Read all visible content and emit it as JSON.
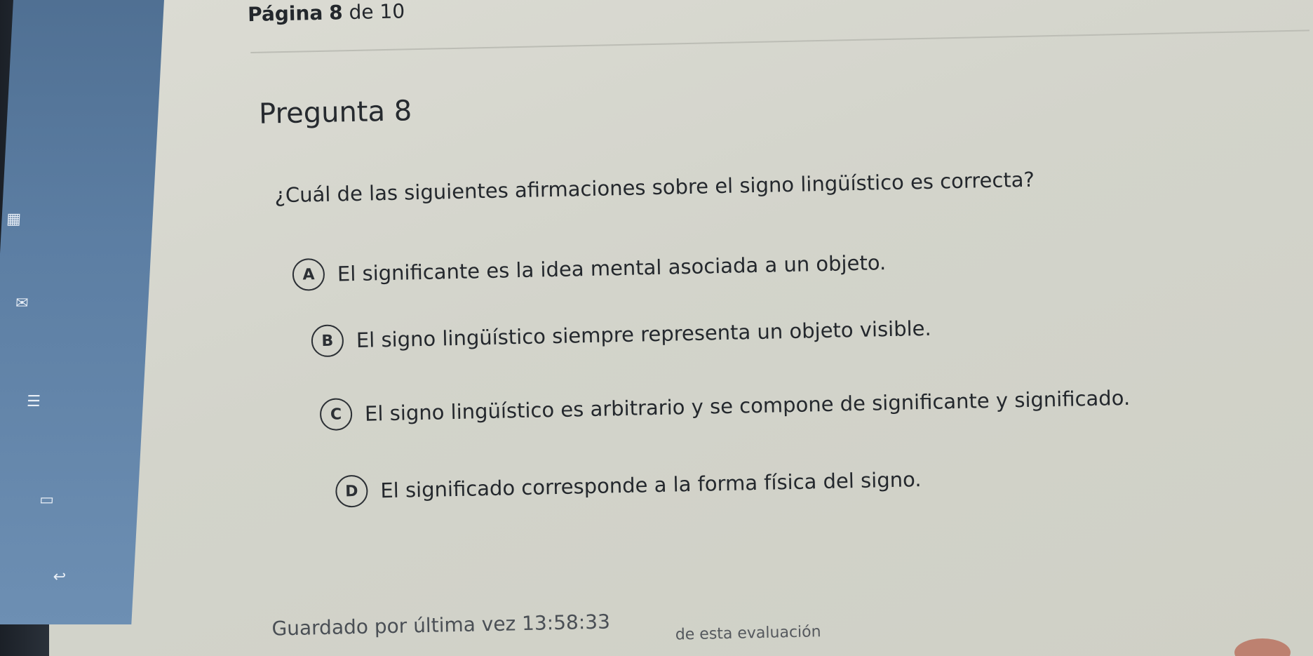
{
  "header": {
    "page_counter_prefix": "Página",
    "page_current": "8",
    "page_counter_sep": "de",
    "page_total": "10"
  },
  "question": {
    "title": "Pregunta 8",
    "text": "¿Cuál de las siguientes afirmaciones sobre el signo lingüístico es correcta?",
    "options": [
      {
        "letter": "A",
        "text": "El significante es la idea mental asociada a un objeto."
      },
      {
        "letter": "B",
        "text": "El signo lingüístico siempre representa un objeto visible."
      },
      {
        "letter": "C",
        "text": "El signo lingüístico es arbitrario y se compone de significante y significado."
      },
      {
        "letter": "D",
        "text": "El significado corresponde a la forma física del signo."
      }
    ]
  },
  "status": {
    "saved_label": "Guardado por última vez 13:58:33",
    "footer_text": "de esta evaluación"
  },
  "sidebar": {
    "icons": [
      "calendar-icon",
      "mail-icon",
      "document-icon",
      "folder-icon",
      "back-arrow-icon"
    ]
  }
}
